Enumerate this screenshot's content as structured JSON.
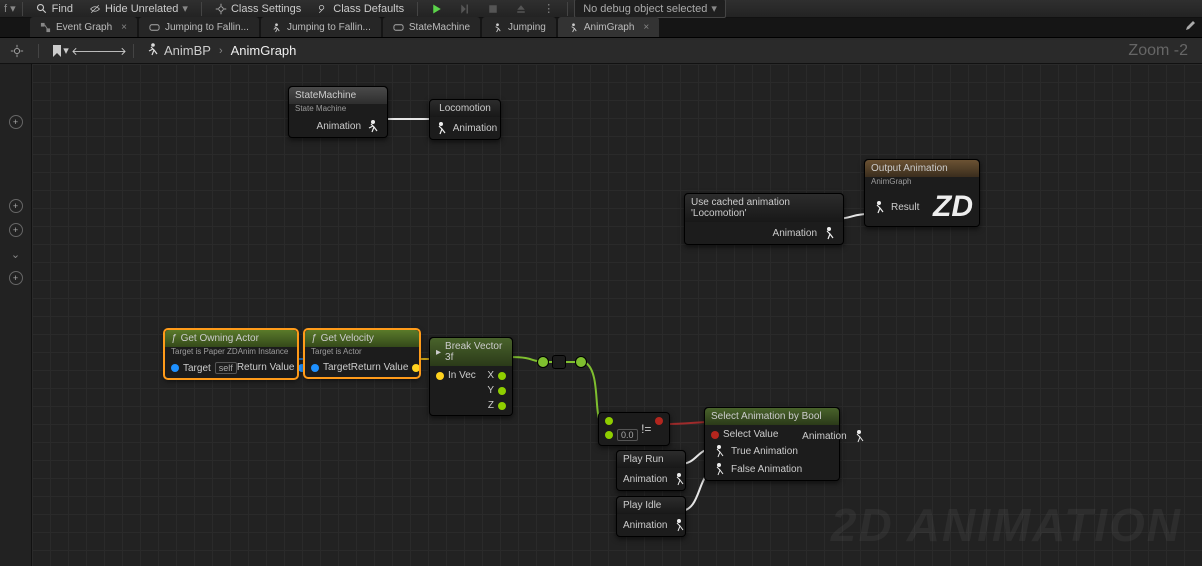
{
  "toolbar": {
    "find": "Find",
    "hide": "Hide Unrelated",
    "settings": "Class Settings",
    "defaults": "Class Defaults",
    "debug": "No debug object selected"
  },
  "tabs": [
    {
      "label": "Event Graph",
      "icon": "graph",
      "closable": true
    },
    {
      "label": "Jumping to Fallin...",
      "icon": "state"
    },
    {
      "label": "Jumping to Fallin...",
      "icon": "run"
    },
    {
      "label": "StateMachine",
      "icon": "state"
    },
    {
      "label": "Jumping",
      "icon": "run"
    },
    {
      "label": "AnimGraph",
      "icon": "run",
      "closable": true,
      "active": true
    }
  ],
  "breadcrumb": {
    "bp": "AnimBP",
    "graph": "AnimGraph",
    "zoom": "Zoom -2"
  },
  "nodes": {
    "statemachine": {
      "title": "StateMachine",
      "sub": "State Machine",
      "out": "Animation"
    },
    "locomotion": {
      "title": "Locomotion",
      "out": "Animation"
    },
    "cached": {
      "title": "Use cached animation 'Locomotion'",
      "out": "Animation"
    },
    "output": {
      "title": "Output Animation",
      "sub": "AnimGraph",
      "in": "Result",
      "zd": "ZD"
    },
    "getowning": {
      "title": "Get Owning Actor",
      "sub": "Target is Paper ZDAnim Instance",
      "tLabel": "Target",
      "tVal": "self",
      "out": "Return Value"
    },
    "getvelocity": {
      "title": "Get Velocity",
      "sub": "Target is Actor",
      "tLabel": "Target",
      "out": "Return Value"
    },
    "break": {
      "title": "Break Vector 3f",
      "in": "In Vec",
      "x": "X",
      "y": "Y",
      "z": "Z"
    },
    "neq": {
      "label": "!=",
      "val": "0.0"
    },
    "select": {
      "title": "Select Animation by Bool",
      "sv": "Select Value",
      "ta": "True Animation",
      "fa": "False Animation",
      "out": "Animation"
    },
    "playrun": {
      "title": "Play Run",
      "out": "Animation"
    },
    "playidle": {
      "title": "Play Idle",
      "out": "Animation"
    }
  },
  "watermark": "2D ANIMATION"
}
